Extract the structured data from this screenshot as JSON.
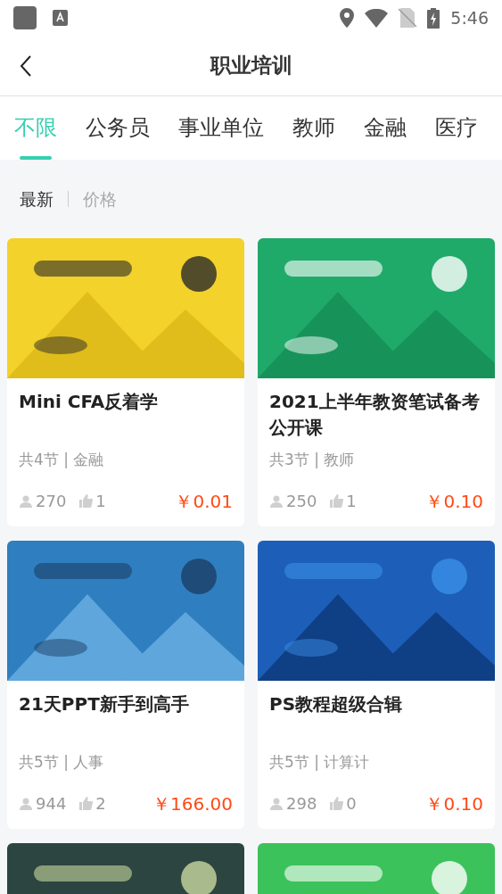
{
  "status_bar": {
    "time": "5:46"
  },
  "header": {
    "title": "职业培训"
  },
  "tabs": [
    {
      "label": "不限",
      "selected": true
    },
    {
      "label": "公务员",
      "selected": false
    },
    {
      "label": "事业单位",
      "selected": false
    },
    {
      "label": "教师",
      "selected": false
    },
    {
      "label": "金融",
      "selected": false
    },
    {
      "label": "医疗",
      "selected": false
    }
  ],
  "sort_options": [
    {
      "label": "最新",
      "selected": true
    },
    {
      "label": "价格",
      "selected": false
    }
  ],
  "courses": [
    {
      "kind": "full",
      "title": "Mini CFA反着学",
      "meta": "共4节 | 金融",
      "students": "270",
      "likes": "1",
      "price": "￥0.01"
    },
    {
      "kind": "full",
      "title": "2021上半年教资笔试备考公开课",
      "meta": "共3节 | 教师",
      "students": "250",
      "likes": "1",
      "price": "￥0.10"
    },
    {
      "kind": "full",
      "title": "21天PPT新手到高手",
      "meta": "共5节 | 人事",
      "students": "944",
      "likes": "2",
      "price": "￥166.00"
    },
    {
      "kind": "full",
      "title": "PS教程超级合辑",
      "meta": "共5节 | 计算计",
      "students": "298",
      "likes": "0",
      "price": "￥0.10"
    },
    {
      "kind": "cut"
    },
    {
      "kind": "cut"
    }
  ]
}
